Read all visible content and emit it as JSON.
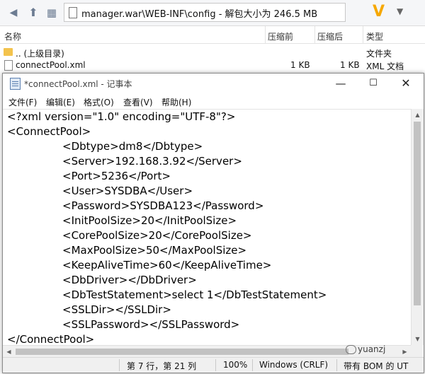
{
  "archive": {
    "path": "manager.war\\WEB-INF\\config - 解包大小为 246.5 MB",
    "columns": [
      "名称",
      "压缩前",
      "压缩后",
      "类型"
    ],
    "rows": [
      {
        "name": ".. (上级目录)",
        "before": "",
        "after": "",
        "type": "文件夹"
      },
      {
        "name": "connectPool.xml",
        "before": "1 KB",
        "after": "1 KB",
        "type": "XML 文档"
      }
    ]
  },
  "notepad": {
    "title": "*connectPool.xml - 记事本",
    "menu": [
      "文件(F)",
      "编辑(E)",
      "格式(O)",
      "查看(V)",
      "帮助(H)"
    ],
    "lines": [
      "<?xml version=\"1.0\" encoding=\"UTF-8\"?>",
      "<ConnectPool>",
      "<Dbtype>dm8</Dbtype>",
      "<Server>192.168.3.92</Server>",
      "<Port>5236</Port>",
      "<User>SYSDBA</User>",
      "<Password>SYSDBA123</Password>",
      "<InitPoolSize>20</InitPoolSize>",
      "<CorePoolSize>20</CorePoolSize>",
      "<MaxPoolSize>50</MaxPoolSize>",
      "<KeepAliveTime>60</KeepAliveTime>",
      "<DbDriver></DbDriver>",
      "<DbTestStatement>select 1</DbTestStatement>",
      "<SSLDir></SSLDir>",
      "<SSLPassword></SSLPassword>",
      "</ConnectPool>"
    ],
    "status": {
      "position": "第 7 行，第 21 列",
      "zoom": "100%",
      "line_ending": "Windows (CRLF)",
      "encoding": "带有 BOM 的 UT"
    }
  },
  "watermark": "yuanzj",
  "icons": {
    "back": "back-arrow-icon",
    "up": "up-arrow-icon",
    "grid": "grid-view-icon",
    "minimize": "minimize-icon",
    "maximize": "maximize-icon",
    "close": "close-icon"
  }
}
